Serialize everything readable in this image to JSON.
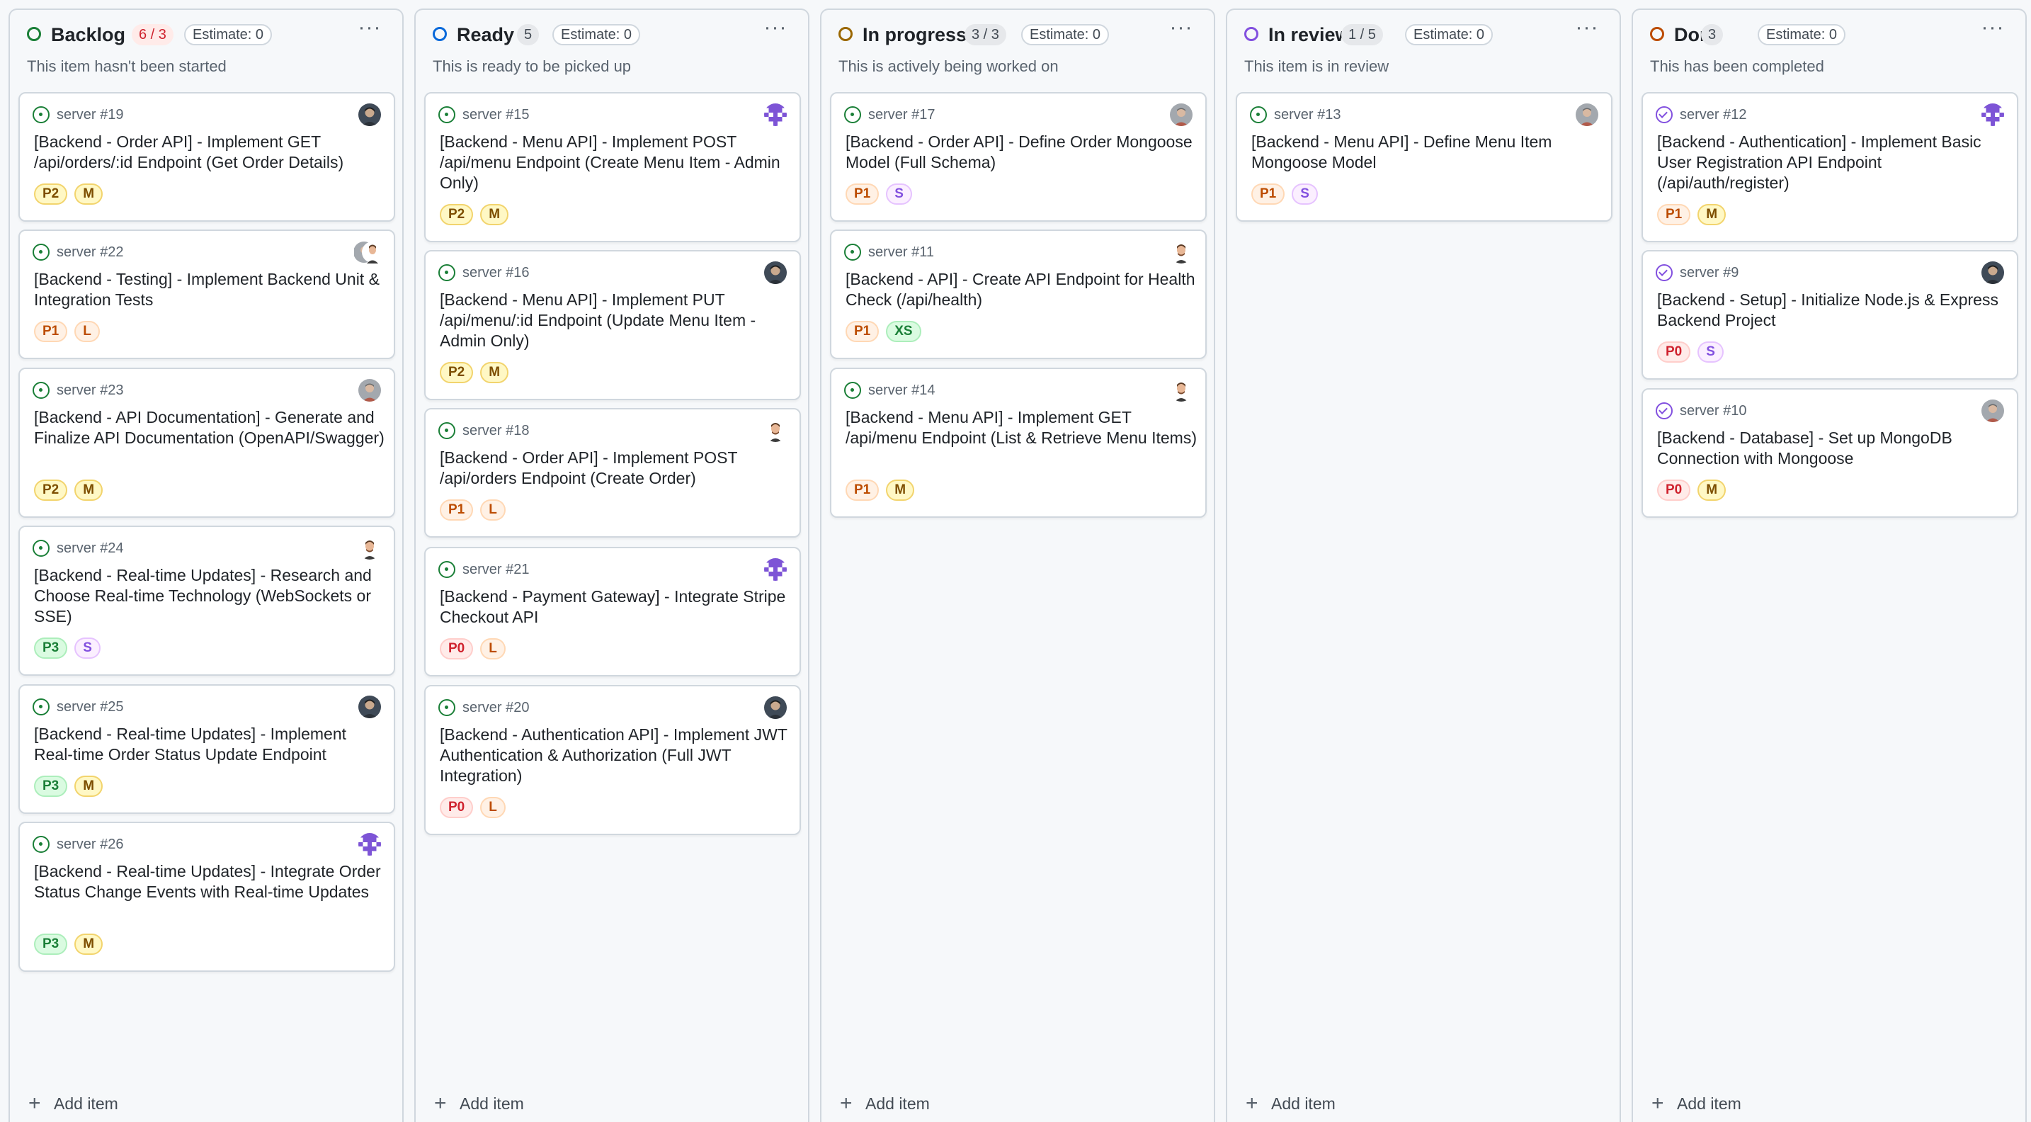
{
  "add_item_label": "Add item",
  "priority_colors": {
    "P0": {
      "bg": "#ffebe9",
      "border": "#ffcecb",
      "fg": "#cf222e"
    },
    "P1": {
      "bg": "#fff1e5",
      "border": "#ffd8b5",
      "fg": "#bc4c00"
    },
    "P2": {
      "bg": "#fff8c5",
      "border": "#f2d46d",
      "fg": "#7d4e00"
    },
    "P3": {
      "bg": "#dafbe1",
      "border": "#aceebb",
      "fg": "#1a7f37"
    }
  },
  "size_colors": {
    "XS": {
      "bg": "#dafbe1",
      "border": "#aceebb",
      "fg": "#1a7f37"
    },
    "S": {
      "bg": "#fbefff",
      "border": "#e6c3ff",
      "fg": "#8250df"
    },
    "M": {
      "bg": "#fff8c5",
      "border": "#f2d46d",
      "fg": "#7d4e00"
    },
    "L": {
      "bg": "#fff1e5",
      "border": "#ffd8b5",
      "fg": "#bc4c00"
    }
  },
  "columns": [
    {
      "title": "Backlog",
      "count": "6 / 3",
      "count_over_limit": true,
      "estimate": "Estimate: 0",
      "description": "This item hasn't been started",
      "status_color": "#1a7f37",
      "cards": [
        {
          "ref": "server #19",
          "title": "[Backend - Order API] - Implement GET /api/orders/:id Endpoint (Get Order Details)",
          "priority": "P2",
          "size": "M",
          "state": "open",
          "avatar": "person-dark-avatar"
        },
        {
          "ref": "server #22",
          "title": "[Backend - Testing] - Implement Backend Unit & Integration Tests",
          "priority": "P1",
          "size": "L",
          "state": "open",
          "avatar": "multiple-assignees-avatar"
        },
        {
          "ref": "server #23",
          "title": "[Backend - API Documentation] - Generate and Finalize API Documentation (OpenAPI/Swagger)",
          "priority": "P2",
          "size": "M",
          "state": "open",
          "avatar": "person-gray-avatar"
        },
        {
          "ref": "server #24",
          "title": "[Backend - Real-time Updates] - Research and Choose Real-time Technology (WebSockets or SSE)",
          "priority": "P3",
          "size": "S",
          "state": "open",
          "avatar": "person-illustrated-avatar"
        },
        {
          "ref": "server #25",
          "title": "[Backend - Real-time Updates] - Implement Real-time Order Status Update Endpoint",
          "priority": "P3",
          "size": "M",
          "state": "open",
          "avatar": "person-dark-avatar"
        },
        {
          "ref": "server #26",
          "title": "[Backend - Real-time Updates] - Integrate Order Status Change Events with Real-time Updates",
          "priority": "P3",
          "size": "M",
          "state": "open",
          "avatar": "identicon-avatar"
        }
      ]
    },
    {
      "title": "Ready",
      "count": "5",
      "count_over_limit": false,
      "estimate": "Estimate: 0",
      "description": "This is ready to be picked up",
      "status_color": "#0969da",
      "cards": [
        {
          "ref": "server #15",
          "title": "[Backend - Menu API] - Implement POST /api/menu Endpoint (Create Menu Item - Admin Only)",
          "priority": "P2",
          "size": "M",
          "state": "open",
          "avatar": "identicon-avatar"
        },
        {
          "ref": "server #16",
          "title": "[Backend - Menu API] - Implement PUT /api/menu/:id Endpoint (Update Menu Item - Admin Only)",
          "priority": "P2",
          "size": "M",
          "state": "open",
          "avatar": "person-dark-avatar"
        },
        {
          "ref": "server #18",
          "title": "[Backend - Order API] - Implement POST /api/orders Endpoint (Create Order)",
          "priority": "P1",
          "size": "L",
          "state": "open",
          "avatar": "person-illustrated-avatar"
        },
        {
          "ref": "server #21",
          "title": "[Backend - Payment Gateway] - Integrate Stripe Checkout API",
          "priority": "P0",
          "size": "L",
          "state": "open",
          "avatar": "identicon-avatar"
        },
        {
          "ref": "server #20",
          "title": "[Backend - Authentication API] - Implement JWT Authentication & Authorization (Full JWT Integration)",
          "priority": "P0",
          "size": "L",
          "state": "open",
          "avatar": "person-dark-avatar"
        }
      ]
    },
    {
      "title": "In progress",
      "count": "3 / 3",
      "count_over_limit": false,
      "estimate": "Estimate: 0",
      "description": "This is actively being worked on",
      "status_color": "#9a6700",
      "cards": [
        {
          "ref": "server #17",
          "title": "[Backend - Order API] - Define Order Mongoose Model (Full Schema)",
          "priority": "P1",
          "size": "S",
          "state": "open",
          "avatar": "person-gray-avatar"
        },
        {
          "ref": "server #11",
          "title": "[Backend - API] - Create API Endpoint for Health Check (/api/health)",
          "priority": "P1",
          "size": "XS",
          "state": "open",
          "avatar": "person-illustrated-avatar"
        },
        {
          "ref": "server #14",
          "title": "[Backend - Menu API] - Implement GET /api/menu Endpoint (List & Retrieve Menu Items)",
          "priority": "P1",
          "size": "M",
          "state": "open",
          "avatar": "person-illustrated-avatar"
        }
      ]
    },
    {
      "title": "In review",
      "count": "1 / 5",
      "count_over_limit": false,
      "estimate": "Estimate: 0",
      "description": "This item is in review",
      "status_color": "#8250df",
      "cards": [
        {
          "ref": "server #13",
          "title": "[Backend - Menu API] - Define Menu Item Mongoose Model",
          "priority": "P1",
          "size": "S",
          "state": "open",
          "avatar": "person-gray-avatar"
        }
      ]
    },
    {
      "title": "Done",
      "count": "3",
      "count_over_limit": false,
      "estimate": "Estimate: 0",
      "description": "This has been completed",
      "status_color": "#bc4c00",
      "cards": [
        {
          "ref": "server #12",
          "title": "[Backend - Authentication] - Implement Basic User Registration API Endpoint (/api/auth/register)",
          "priority": "P1",
          "size": "M",
          "state": "closed",
          "avatar": "identicon-avatar"
        },
        {
          "ref": "server #9",
          "title": "[Backend - Setup] - Initialize Node.js & Express Backend Project",
          "priority": "P0",
          "size": "S",
          "state": "closed",
          "avatar": "person-dark-avatar"
        },
        {
          "ref": "server #10",
          "title": "[Backend - Database] - Set up MongoDB Connection with Mongoose",
          "priority": "P0",
          "size": "M",
          "state": "closed",
          "avatar": "person-gray-avatar"
        }
      ]
    }
  ]
}
